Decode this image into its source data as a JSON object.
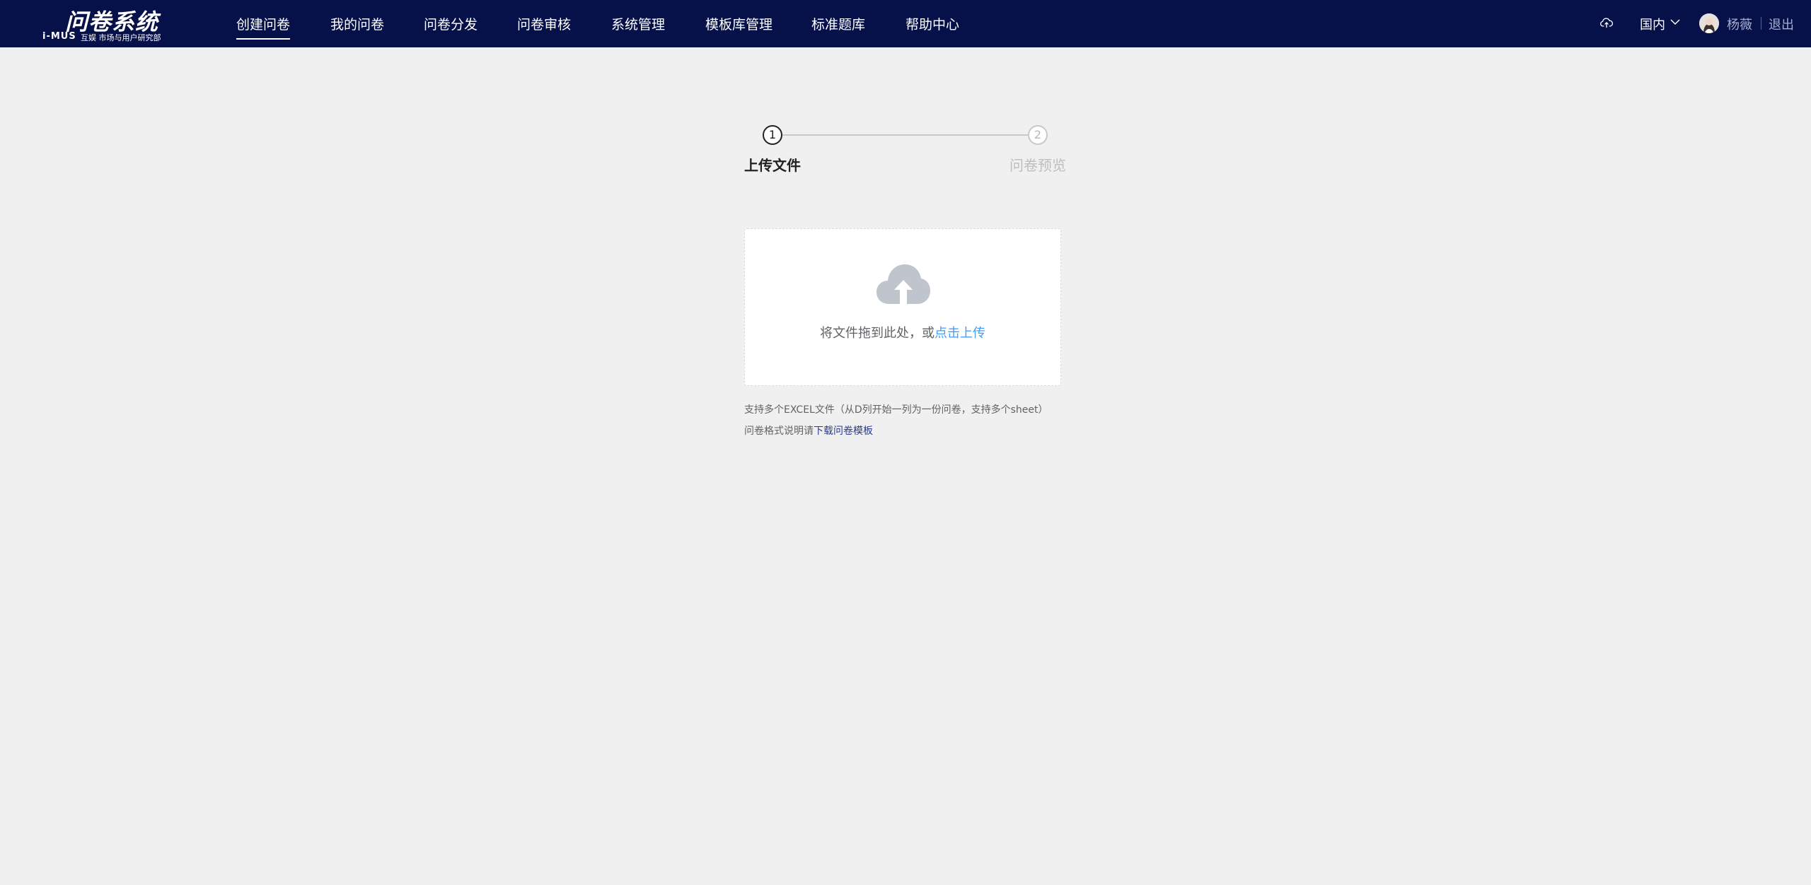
{
  "header": {
    "logo": {
      "title": "问卷系统",
      "brand": "i-MUS",
      "subtitle": "互娱 市场与用户研究部"
    },
    "nav": [
      {
        "label": "创建问卷",
        "active": true
      },
      {
        "label": "我的问卷",
        "active": false
      },
      {
        "label": "问卷分发",
        "active": false
      },
      {
        "label": "问卷审核",
        "active": false
      },
      {
        "label": "系统管理",
        "active": false
      },
      {
        "label": "模板库管理",
        "active": false
      },
      {
        "label": "标准题库",
        "active": false
      },
      {
        "label": "帮助中心",
        "active": false
      }
    ],
    "region": "国内",
    "username": "杨薇",
    "logout": "退出"
  },
  "steps": [
    {
      "number": "1",
      "label": "上传文件",
      "active": true
    },
    {
      "number": "2",
      "label": "问卷预览",
      "active": false
    }
  ],
  "upload": {
    "text": "将文件拖到此处，或",
    "link": "点击上传"
  },
  "tips": {
    "line1": "支持多个EXCEL文件（从D列开始一列为一份问卷，支持多个sheet）",
    "line2_prefix": "问卷格式说明请",
    "line2_link": "下载问卷模板"
  },
  "colors": {
    "header_bg": "#061049",
    "page_bg": "#f0f0f0",
    "link": "#409eff",
    "template_link": "#2b3a8c"
  }
}
